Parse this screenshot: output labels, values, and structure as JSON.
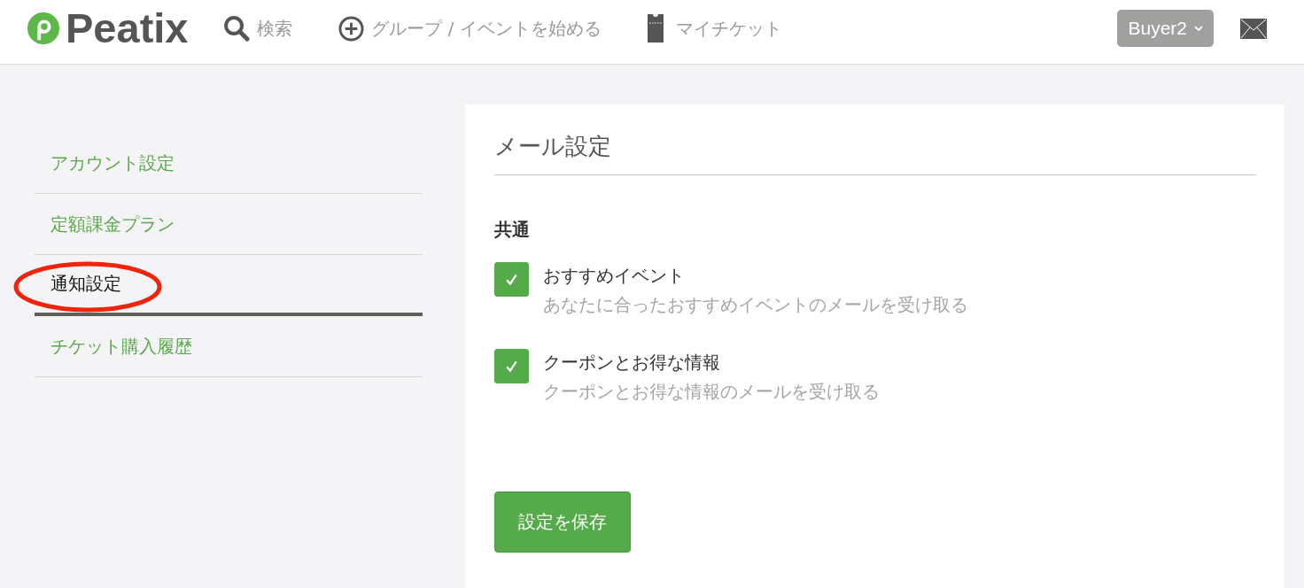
{
  "header": {
    "logo": {
      "text": "Peatix"
    },
    "nav": [
      {
        "kind": "search",
        "label": "検索"
      },
      {
        "kind": "create",
        "label": "グループ / イベントを始める"
      },
      {
        "kind": "tickets",
        "label": "マイチケット"
      }
    ],
    "user_menu": {
      "label": "Buyer2"
    }
  },
  "sidebar": {
    "items": [
      {
        "label": "アカウント設定",
        "selected": false,
        "circled": false
      },
      {
        "label": "定額課金プラン",
        "selected": false,
        "circled": false
      },
      {
        "label": "通知設定",
        "selected": true,
        "circled": true
      },
      {
        "label": "チケット購入履歴",
        "selected": false,
        "circled": false
      }
    ]
  },
  "panel": {
    "title": "メール設定",
    "section": {
      "heading": "共通",
      "options": [
        {
          "label": "おすすめイベント",
          "description": "あなたに合ったおすすめイベントのメールを受け取る",
          "checked": true
        },
        {
          "label": "クーポンとお得な情報",
          "description": "クーポンとお得な情報のメールを受け取る",
          "checked": true
        }
      ]
    },
    "save_button": "設定を保存"
  }
}
